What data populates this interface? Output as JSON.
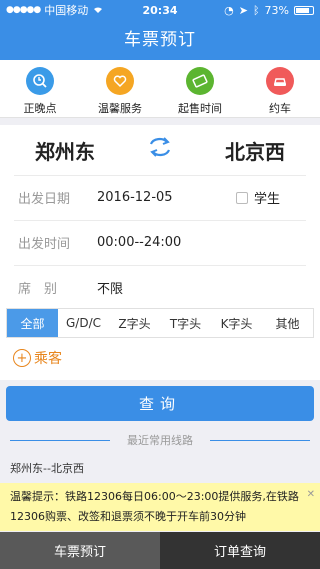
{
  "status_bar": {
    "carrier": "中国移动",
    "time": "20:34",
    "battery": "73%",
    "battery_level": 0.73
  },
  "header": {
    "title": "车票预订"
  },
  "quick_links": [
    {
      "label": "正晚点",
      "icon": "clock-search-icon",
      "color": "#3a9be8"
    },
    {
      "label": "温馨服务",
      "icon": "heart-hands-icon",
      "color": "#f5a623"
    },
    {
      "label": "起售时间",
      "icon": "ticket-icon",
      "color": "#5cb531"
    },
    {
      "label": "约车",
      "icon": "car-icon",
      "color": "#f05a5a"
    }
  ],
  "booking": {
    "from_station": "郑州东",
    "to_station": "北京西",
    "date_label": "出发日期",
    "date_value": "2016-12-05",
    "student_label": "学生",
    "time_label": "出发时间",
    "time_value": "00:00--24:00",
    "seat_label": "席　别",
    "seat_value": "不限"
  },
  "train_filters": [
    {
      "label": "全部",
      "active": true
    },
    {
      "label": "G/D/C",
      "active": false
    },
    {
      "label": "Z字头",
      "active": false
    },
    {
      "label": "T字头",
      "active": false
    },
    {
      "label": "K字头",
      "active": false
    },
    {
      "label": "其他",
      "active": false
    }
  ],
  "passenger": {
    "label": "乘客"
  },
  "query_button": {
    "label": "查询"
  },
  "recent": {
    "title": "最近常用线路",
    "items": [
      "郑州东--北京西"
    ]
  },
  "notice": {
    "text": "温馨提示：铁路12306每日06:00～23:00提供服务,在铁路12306购票、改签和退票须不晚于开车前30分钟"
  },
  "tab_bar": [
    {
      "label": "车票预订",
      "active": true
    },
    {
      "label": "订单查询",
      "active": false
    }
  ]
}
